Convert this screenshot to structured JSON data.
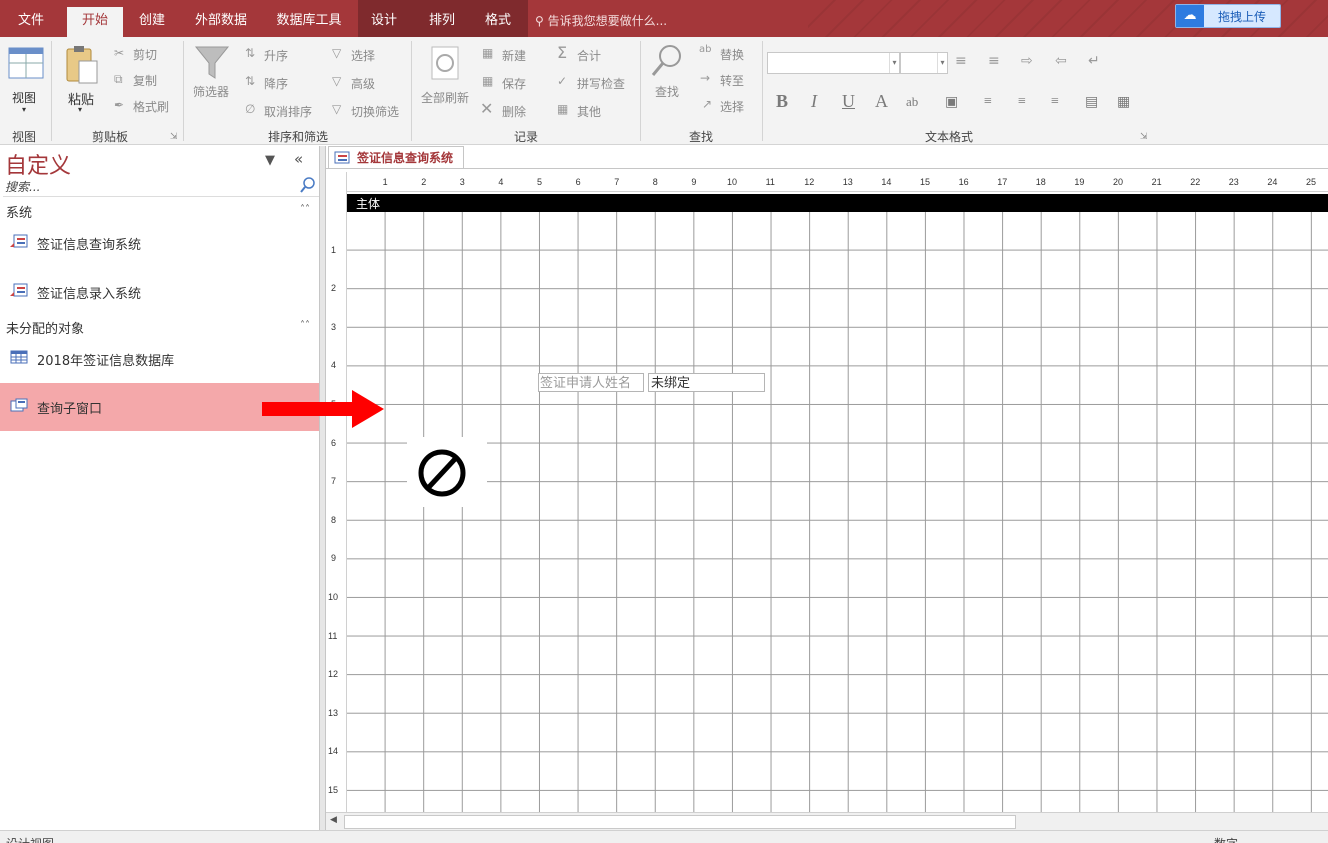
{
  "ribbon_tabs": [
    "文件",
    "开始",
    "创建",
    "外部数据",
    "数据库工具",
    "设计",
    "排列",
    "格式"
  ],
  "tell_me": "告诉我您想要做什么...",
  "upload_label": "拖拽上传",
  "groups": {
    "views": {
      "label": "视图",
      "view_btn": "视图"
    },
    "clipboard": {
      "label": "剪贴板",
      "paste": "粘贴",
      "cut": "剪切",
      "copy": "复制",
      "format_painter": "格式刷"
    },
    "sort_filter": {
      "label": "排序和筛选",
      "filter": "筛选器",
      "asc": "升序",
      "desc": "降序",
      "remove_sort": "取消排序",
      "selection": "选择",
      "advanced": "高级",
      "toggle_filter": "切换筛选"
    },
    "records": {
      "label": "记录",
      "refresh_all": "全部刷新",
      "new": "新建",
      "save": "保存",
      "delete": "删除",
      "totals": "合计",
      "spelling": "拼写检查",
      "more": "其他"
    },
    "find": {
      "label": "查找",
      "find": "查找",
      "replace": "替换",
      "goto": "转至",
      "select": "选择"
    },
    "text_format": {
      "label": "文本格式"
    }
  },
  "nav": {
    "title": "自定义",
    "search_placeholder": "搜索...",
    "groups": [
      {
        "name": "系统",
        "items": [
          "签证信息查询系统",
          "签证信息录入系统"
        ]
      },
      {
        "name": "未分配的对象",
        "items": [
          "2018年签证信息数据库",
          "查询子窗口"
        ]
      }
    ]
  },
  "document": {
    "tab_title": "签证信息查询系统",
    "section": "主体",
    "label_control": "签证申请人姓名",
    "text_control": "未绑定",
    "ruler_h": [
      "1",
      "2",
      "3",
      "4",
      "5",
      "6",
      "7",
      "8",
      "9",
      "10",
      "11",
      "12",
      "13",
      "14",
      "15",
      "16",
      "17",
      "18",
      "19",
      "20",
      "21",
      "22",
      "23",
      "24",
      "25"
    ],
    "ruler_v": [
      "1",
      "2",
      "3",
      "4",
      "5",
      "6",
      "7",
      "8",
      "9",
      "10",
      "11",
      "12",
      "13",
      "14",
      "15"
    ]
  },
  "status": {
    "left": "设计视图",
    "right": "数字"
  },
  "colors": {
    "accent": "#a4373a",
    "selected_nav": "#f4a8aa",
    "arrow": "#ff0000"
  }
}
